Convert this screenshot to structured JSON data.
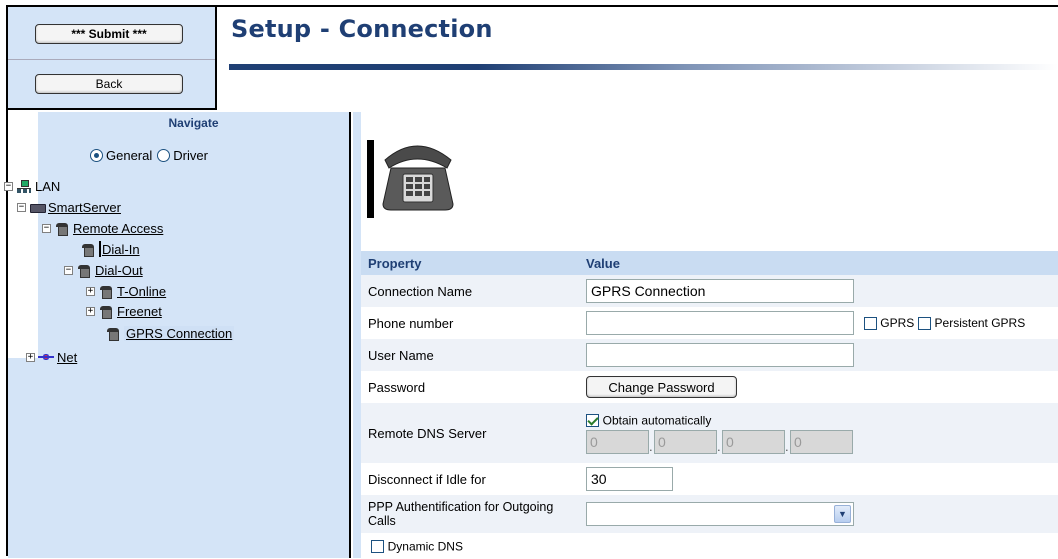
{
  "header": {
    "submit_label": "*** Submit ***",
    "back_label": "Back",
    "title": "Setup - Connection"
  },
  "nav": {
    "title": "Navigate",
    "radio_general": "General",
    "radio_driver": "Driver",
    "selected_mode": "General",
    "tree": {
      "lan": "LAN",
      "smartserver": "SmartServer",
      "remote_access": "Remote Access",
      "dial_in": "Dial-In",
      "dial_out": "Dial-Out",
      "t_online": "T-Online",
      "freenet": "Freenet",
      "gprs_connection": "GPRS Connection",
      "net": "Net"
    }
  },
  "table": {
    "col_property": "Property",
    "col_value": "Value",
    "connection_name_label": "Connection Name",
    "connection_name_value": "GPRS Connection",
    "phone_label": "Phone number",
    "phone_value": "",
    "gprs_label": "GPRS",
    "gprs_checked": false,
    "persistent_gprs_label": "Persistent GPRS",
    "persistent_gprs_checked": false,
    "user_name_label": "User Name",
    "user_name_value": "",
    "password_label": "Password",
    "change_password_label": "Change Password",
    "remote_dns_label": "Remote DNS Server",
    "obtain_auto_label": "Obtain automatically",
    "obtain_auto_checked": true,
    "dns_octets": [
      "0",
      "0",
      "0",
      "0"
    ],
    "disconnect_label": "Disconnect if Idle for",
    "disconnect_value": "30",
    "ppp_label": "PPP Authentification for Outgoing Calls",
    "ppp_value": "",
    "dynamic_dns_label": "Dynamic DNS",
    "dynamic_dns_checked": false
  },
  "colors": {
    "accent": "#1f3f74",
    "panel": "#d4e4f7",
    "header_row": "#c9dcf2",
    "selected": "#cfe0f5"
  }
}
